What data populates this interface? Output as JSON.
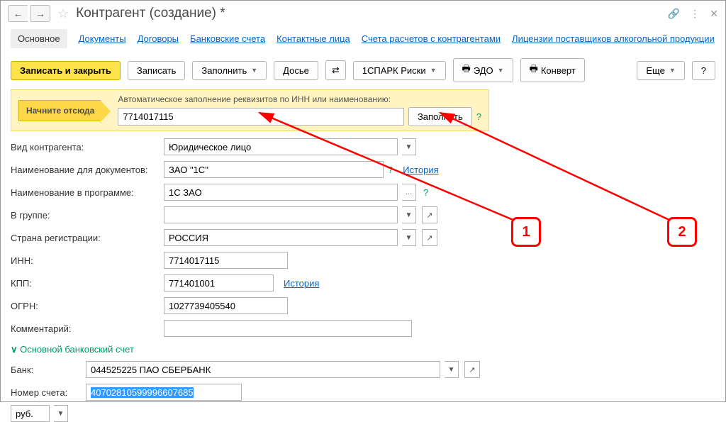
{
  "header": {
    "title": "Контрагент (создание) *"
  },
  "tabs": {
    "active": "Основное",
    "items": [
      "Документы",
      "Договоры",
      "Банковские счета",
      "Контактные лица",
      "Счета расчетов с контрагентами",
      "Лицензии поставщиков алкогольной продукции"
    ]
  },
  "toolbar": {
    "save_close": "Записать и закрыть",
    "save": "Записать",
    "fill": "Заполнить",
    "dossier": "Досье",
    "spark": "1СПАРК Риски",
    "edo": "ЭДО",
    "envelope": "Конверт",
    "more": "Еще",
    "help": "?"
  },
  "start": {
    "hint": "Начните отсюда",
    "label": "Автоматическое заполнение реквизитов по ИНН или наименованию:",
    "value": "7714017115",
    "fill_btn": "Заполнить",
    "q": "?"
  },
  "form": {
    "type_lbl": "Вид контрагента:",
    "type_val": "Юридическое лицо",
    "docname_lbl": "Наименование для документов:",
    "docname_val": "ЗАО \"1С\"",
    "docname_q": "?",
    "history": "История",
    "progname_lbl": "Наименование в программе:",
    "progname_val": "1С ЗАО",
    "progname_q": "?",
    "group_lbl": "В группе:",
    "group_val": "",
    "country_lbl": "Страна регистрации:",
    "country_val": "РОССИЯ",
    "inn_lbl": "ИНН:",
    "inn_val": "7714017115",
    "kpp_lbl": "КПП:",
    "kpp_val": "771401001",
    "ogrn_lbl": "ОГРН:",
    "ogrn_val": "1027739405540",
    "comment_lbl": "Комментарий:",
    "comment_val": "",
    "bank_section": "Основной банковский счет",
    "bank_lbl": "Банк:",
    "bank_val": "044525225 ПАО СБЕРБАНК",
    "acct_lbl": "Номер счета:",
    "acct_val": "40702810599996607685",
    "currency": "руб."
  },
  "annotations": {
    "a1": "1",
    "a2": "2"
  }
}
